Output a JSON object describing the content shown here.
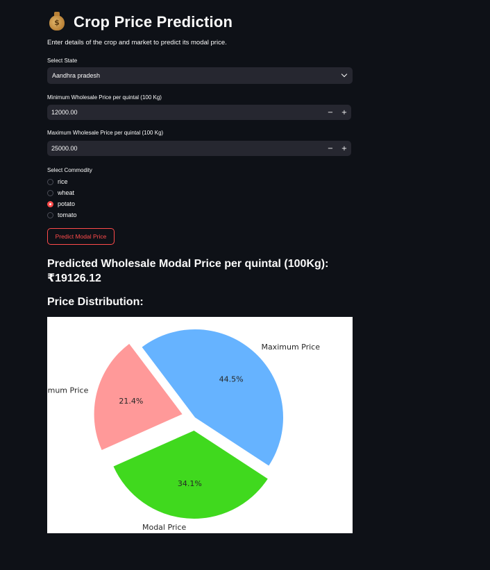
{
  "header": {
    "icon": "money-bag-icon",
    "title": "Crop Price Prediction",
    "subtitle": "Enter details of the crop and market to predict its modal price."
  },
  "form": {
    "state_label": "Select State",
    "state_value": "Aandhra pradesh",
    "min_label": "Minimum Wholesale Price per quintal (100 Kg)",
    "min_value": "12000.00",
    "max_label": "Maximum Wholesale Price per quintal (100 Kg)",
    "max_value": "25000.00",
    "decrement_symbol": "−",
    "increment_symbol": "+",
    "commodity_label": "Select Commodity",
    "commodities": [
      {
        "label": "rice",
        "selected": false
      },
      {
        "label": "wheat",
        "selected": false
      },
      {
        "label": "potato",
        "selected": true
      },
      {
        "label": "tomato",
        "selected": false
      }
    ],
    "button_label": "Predict Modal Price"
  },
  "result": {
    "label": "Predicted Wholesale Modal Price per quintal (100Kg):",
    "value": "₹19126.12"
  },
  "distribution_heading": "Price Distribution:",
  "colors": {
    "accent": "#ff4b4b",
    "background": "#0e1117",
    "input_bg": "#262730"
  },
  "chart_data": {
    "type": "pie",
    "labels": [
      "Maximum Price",
      "Modal Price",
      "Minimum Price"
    ],
    "values": [
      44.5,
      34.1,
      21.4
    ],
    "value_labels": [
      "44.5%",
      "34.1%",
      "21.4%"
    ],
    "colors": [
      "#66b3ff",
      "#40d91e",
      "#ff9999"
    ],
    "exploded": [
      false,
      true,
      true
    ]
  }
}
